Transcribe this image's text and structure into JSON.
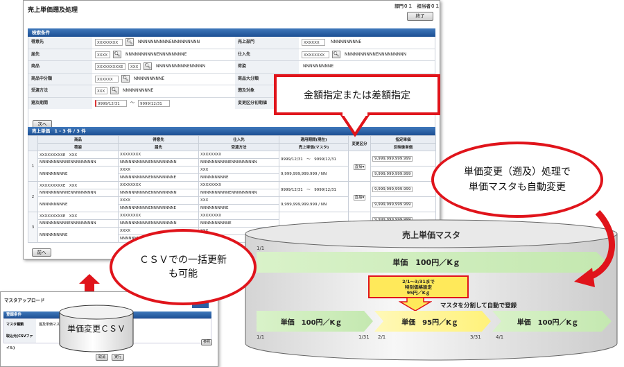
{
  "main_window": {
    "title": "売上単価遡及処理",
    "header_info": "部門０１　担当者０１",
    "close_button": "終了",
    "criteria": {
      "section_title": "検索条件",
      "rows": [
        {
          "label1": "得意先",
          "input1": "XXXXXXXX",
          "text1": "NNNNNNNNNNENNNNNNNNN",
          "label2": "売上部門",
          "input2": "XXXXXX",
          "text2": "NNNNNNNNNE"
        },
        {
          "label1": "届先",
          "input1": "XXXX",
          "text1": "NNNNNNNNNNENNNNNNNNE",
          "label2": "仕入先",
          "input2": "XXXXXXXX",
          "text2": "NNNNNNNNNNENNNNNNNNN"
        },
        {
          "label1": "商品",
          "input1": "XXXXXXXXXE",
          "input1b": "XXX",
          "text1": "NNNNNNNNNNENNNNN",
          "label2": "荷姿",
          "text2": "NNNNNNNNNE"
        },
        {
          "label1": "商品中分類",
          "input1": "XXXXXX",
          "text1": "NNNNNNNNNE",
          "label2": "商品大分類"
        },
        {
          "label1": "受渡方法",
          "input1": "XXX",
          "text1": "NNNNNNNNNE",
          "label2": "遡及対象"
        },
        {
          "label1": "遡及期間",
          "date_from": "9999/12/31",
          "range_sep": "～",
          "date_to": "9999/12/31",
          "label2": "変更区分初期値"
        }
      ],
      "next_button": "次へ"
    },
    "results": {
      "section_title": "売上単価　1 - 3 件 / 3 件",
      "headers_top": [
        "商品",
        "得意先",
        "仕入先",
        "適用期間(現在)",
        "変更区分",
        "指定単価"
      ],
      "headers_bottom": [
        "荷姿",
        "届先",
        "受渡方法",
        "売上単価(マスタ)",
        "反映後単価"
      ],
      "rows": [
        {
          "no": "1",
          "product": "XXXXXXXXXE　XXX",
          "product_name": "NNNNNNNNNNENNNNNNNNN",
          "packaging": "NNNNNNNNNE",
          "customer": "XXXXXXXX",
          "customer_name": "NNNNNNNNNNENNNNNNNNN",
          "ship_to": "XXXX",
          "ship_to_name": "NNNNNNNNNNENNNNNNNNE",
          "supplier": "XXXXXXXX",
          "supplier_name": "NNNNNNNNNNENNNNNNNNN",
          "delivery": "XXX",
          "delivery_name": "NNNNNNNNNE",
          "period_from": "9999/12/31",
          "period_sep": "～",
          "period_to": "9999/12/31",
          "master_price": "9,999,999,999.999",
          "unit": "/ NN",
          "change_type": "直接",
          "specified_price": "9,999,999,999.999",
          "reflected_price": "9,999,999,999.999"
        },
        {
          "no": "2",
          "product": "XXXXXXXXXE　XXX",
          "product_name": "NNNNNNNNNNENNNNNNNNN",
          "packaging": "NNNNNNNNNE",
          "customer": "XXXXXXXX",
          "customer_name": "NNNNNNNNNNENNNNNNNNN",
          "ship_to": "XXXX",
          "ship_to_name": "NNNNNNNNNNENNNNNNNNE",
          "supplier": "XXXXXXXX",
          "supplier_name": "NNNNNNNNNNENNNNNNNNN",
          "delivery": "XXX",
          "delivery_name": "NNNNNNNNNE",
          "period_from": "9999/12/31",
          "period_sep": "～",
          "period_to": "9999/12/31",
          "master_price": "9,999,999,999.999",
          "unit": "/ NN",
          "change_type": "直接",
          "specified_price": "9,999,999,999.999",
          "reflected_price": "9,999,999,999.999"
        },
        {
          "no": "3",
          "product": "XXXXXXXXXE　XXX",
          "product_name": "NNNNNNNNNNENNNNNNNNN",
          "packaging": "NNNNNNNNNE",
          "customer": "XXXXXXXX",
          "customer_name": "NNNNNNNNNNENNNNNNNNN",
          "ship_to": "XXXX",
          "ship_to_name": "NNNNNNNNNNE",
          "supplier": "XXXXXXXX",
          "supplier_name": "NNNNNNNNNNE",
          "delivery": "XXX",
          "delivery_name": "",
          "period_from": "",
          "period_sep": "",
          "period_to": "",
          "master_price": "",
          "unit": "",
          "change_type": "",
          "specified_price": "9,999,999,999.999",
          "reflected_price": ""
        }
      ],
      "prev_button": "前へ"
    }
  },
  "upload_window": {
    "title": "マスタアップロード",
    "section_title": "登録条件",
    "row1_label": "マスタ種類",
    "row1_value": "遡及単価マスタ",
    "row2_label": "取込元(CSVファイル)",
    "browse_button": "参照",
    "btn_left": "取消",
    "btn_right": "実行",
    "cylinder_label": "単価変更ＣＳＶ"
  },
  "callouts": {
    "amount_box": "金額指定または差額指定",
    "price_change": "単価変更（遡及）処理で\n単価マスタも自動変更",
    "csv_bulk": "ＣＳＶでの一括更新\nも可能"
  },
  "master_db": {
    "title": "売上単価マスタ",
    "top_start": "1/1",
    "top_bar": "単価　100円／Kｇ",
    "yellow_note": "2/1～3/31まで\n特別価格設定\n95円／Kｇ",
    "split_note": "マスタを分割して自動で登録",
    "seg1": "単価　100円／Kｇ",
    "seg2": "単価　95円／Kｇ",
    "seg3": "単価　100円／Kｇ",
    "d1": "1/1",
    "d2": "1/31",
    "d3": "2/1",
    "d4": "3/31",
    "d5": "4/1"
  }
}
